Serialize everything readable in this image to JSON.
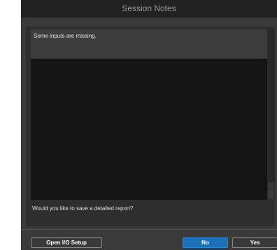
{
  "window": {
    "title": "Session Notes"
  },
  "notes": {
    "text": "Some inputs are missing."
  },
  "dialog": {
    "question": "Would you like to save a detailed report?"
  },
  "buttons": {
    "open_io_setup": "Open I/O Setup",
    "no": "No",
    "yes": "Yes"
  },
  "colors": {
    "window_bg": "#3a3a3a",
    "titlebar_bg": "#222222",
    "notes_bg": "#141414",
    "primary_button": "#1d70b8"
  }
}
